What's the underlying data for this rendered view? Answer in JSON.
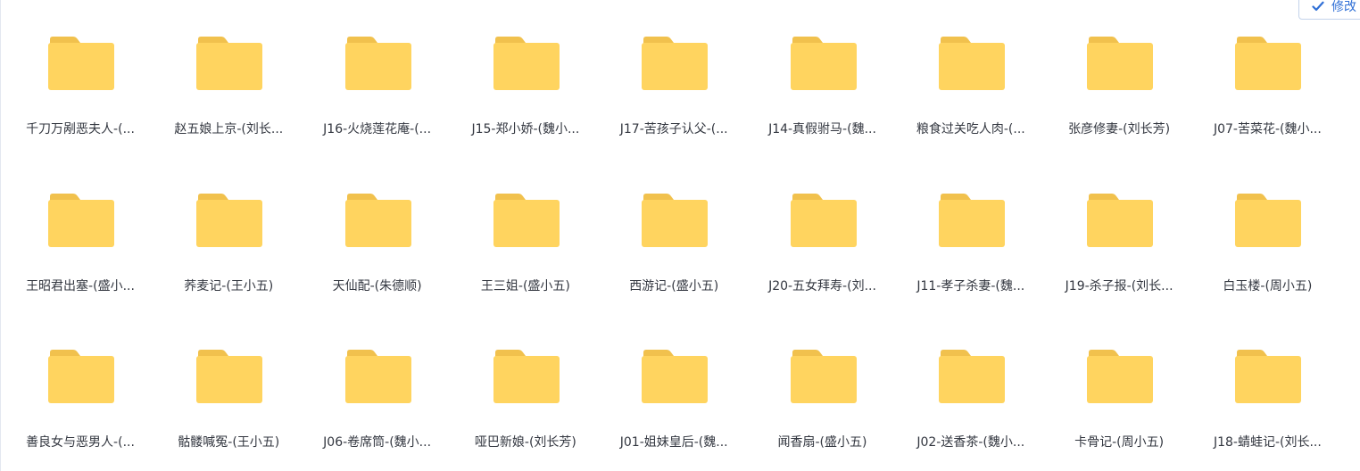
{
  "toolbar": {
    "edit_label": "修改",
    "edit_icon": "checkmark-icon",
    "accent_color": "#2f6fd6"
  },
  "folder_color": "#ffd45f",
  "folder_tab_color": "#f1c14d",
  "folders": [
    {
      "label": "千刀万剐恶夫人-(..."
    },
    {
      "label": "赵五娘上京-(刘长..."
    },
    {
      "label": "J16-火烧莲花庵-(..."
    },
    {
      "label": "J15-郑小娇-(魏小..."
    },
    {
      "label": "J17-苦孩子认父-(..."
    },
    {
      "label": "J14-真假驸马-(魏..."
    },
    {
      "label": "粮食过关吃人肉-(..."
    },
    {
      "label": "张彦修妻-(刘长芳)"
    },
    {
      "label": "J07-苦菜花-(魏小..."
    },
    {
      "label": "王昭君出塞-(盛小..."
    },
    {
      "label": "荞麦记-(王小五)"
    },
    {
      "label": "天仙配-(朱德顺)"
    },
    {
      "label": "王三姐-(盛小五)"
    },
    {
      "label": "西游记-(盛小五)"
    },
    {
      "label": "J20-五女拜寿-(刘..."
    },
    {
      "label": "J11-孝子杀妻-(魏..."
    },
    {
      "label": "J19-杀子报-(刘长..."
    },
    {
      "label": "白玉楼-(周小五)"
    },
    {
      "label": "善良女与恶男人-(..."
    },
    {
      "label": "骷髅喊冤-(王小五)"
    },
    {
      "label": "J06-卷席筒-(魏小..."
    },
    {
      "label": "哑巴新娘-(刘长芳)"
    },
    {
      "label": "J01-姐妹皇后-(魏..."
    },
    {
      "label": "闻香扇-(盛小五)"
    },
    {
      "label": "J02-送香茶-(魏小..."
    },
    {
      "label": "卡骨记-(周小五)"
    },
    {
      "label": "J18-蜻蛙记-(刘长..."
    }
  ]
}
